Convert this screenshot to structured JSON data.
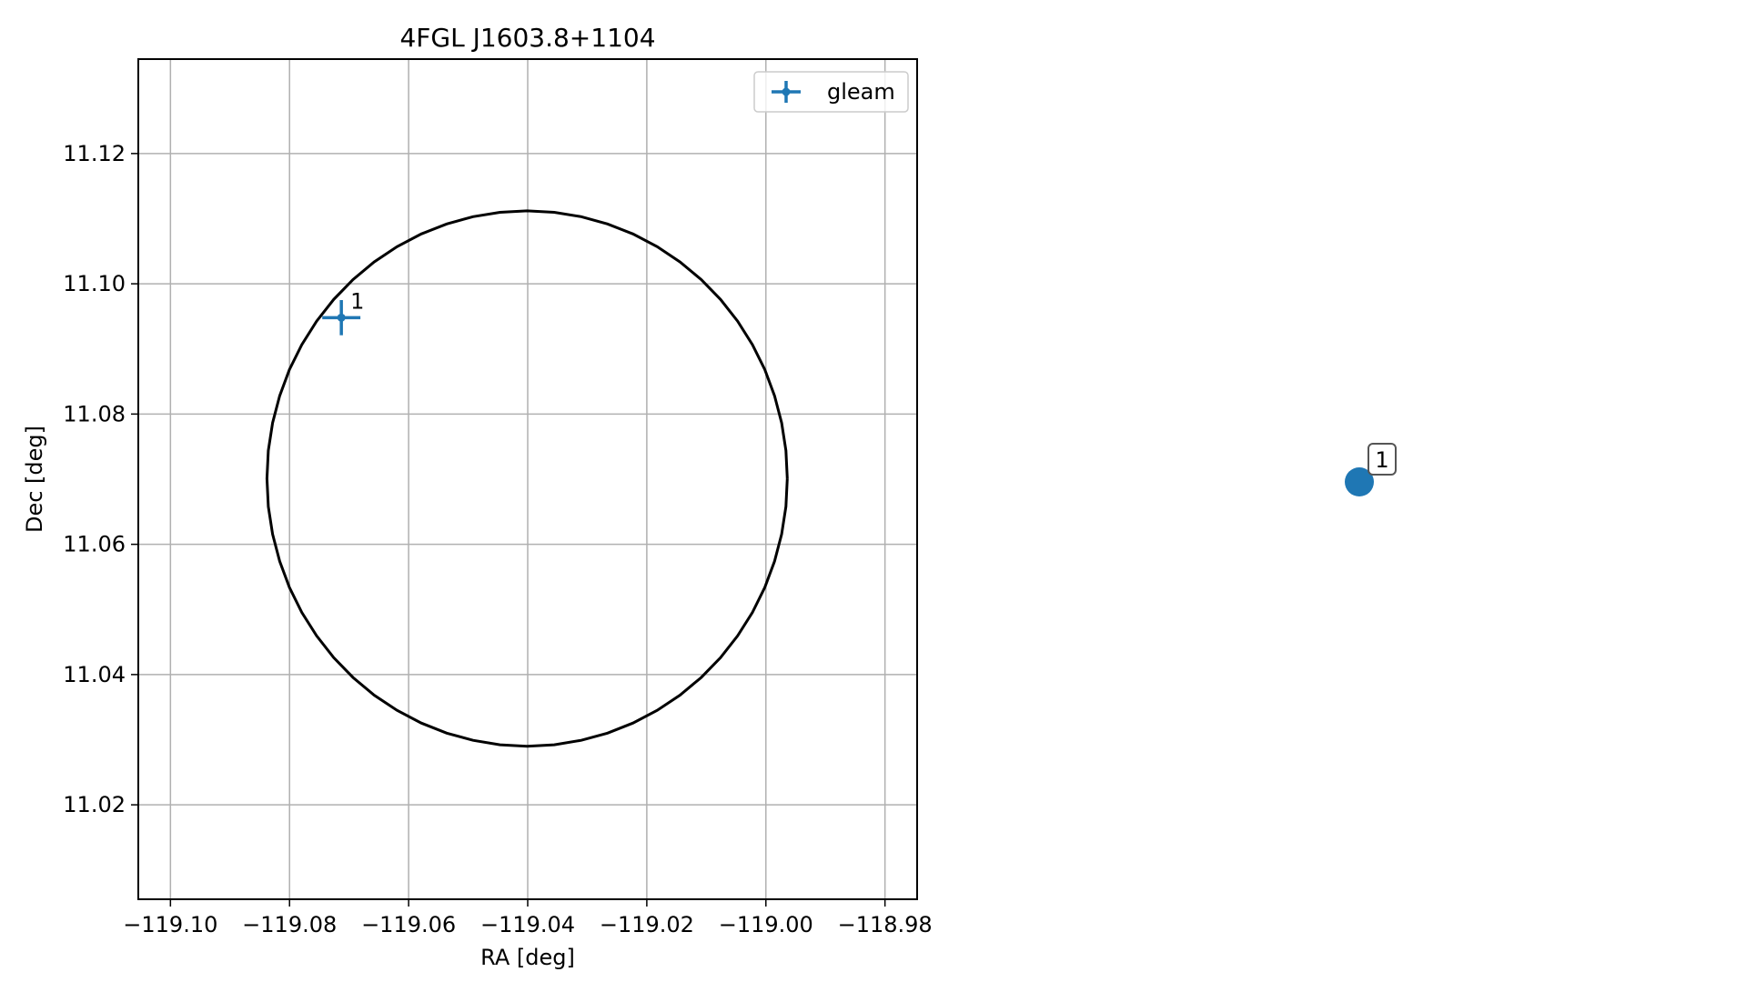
{
  "chart_data": [
    {
      "type": "scatter",
      "title": "4FGL J1603.8+1104",
      "xlabel": "RA [deg]",
      "ylabel": "Dec [deg]",
      "xlim": [
        -119.1054,
        -118.9746
      ],
      "ylim": [
        11.0055,
        11.1345
      ],
      "grid": true,
      "legend_position": "top-right",
      "x_ticks": [
        -119.1,
        -119.08,
        -119.06,
        -119.04,
        -119.02,
        -119.0,
        -118.98
      ],
      "x_tick_labels": [
        "−119.10",
        "−119.08",
        "−119.06",
        "−119.04",
        "−119.02",
        "−119.00",
        "−118.98"
      ],
      "y_ticks": [
        11.02,
        11.04,
        11.06,
        11.08,
        11.1,
        11.12
      ],
      "y_tick_labels": [
        "11.02",
        "11.04",
        "11.06",
        "11.08",
        "11.10",
        "11.12"
      ],
      "series": [
        {
          "name": "gleam",
          "color": "#1f77b4",
          "points": [
            {
              "x": -119.0713,
              "y": 11.0948,
              "xerr": 0.0032,
              "yerr": 0.0027,
              "label": "1"
            }
          ]
        }
      ],
      "ellipse": {
        "center_x": -119.0401,
        "center_y": 11.0701,
        "semi_axis_x": 0.0437,
        "semi_axis_y": 0.0411,
        "color": "#000000"
      }
    },
    {
      "type": "scatter",
      "series": [
        {
          "color": "#1f77b4",
          "points": [
            {
              "label": "1"
            }
          ]
        }
      ]
    }
  ]
}
